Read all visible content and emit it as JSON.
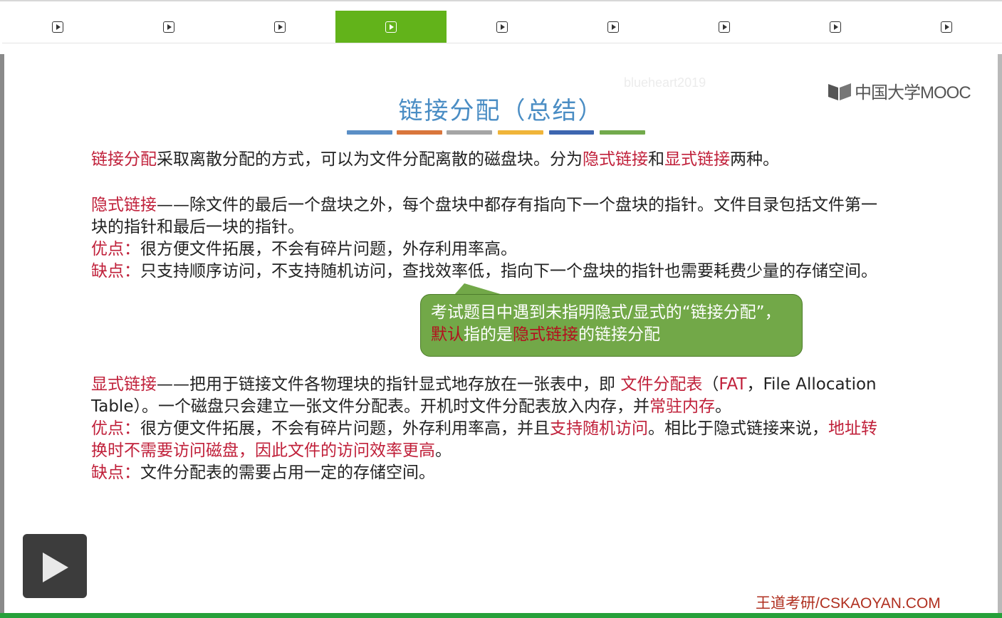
{
  "tabs": [
    {
      "icon": "play-icon",
      "active": false
    },
    {
      "icon": "play-icon",
      "active": false
    },
    {
      "icon": "play-icon",
      "active": false
    },
    {
      "icon": "play-icon",
      "active": true
    },
    {
      "icon": "play-icon",
      "active": false
    },
    {
      "icon": "play-icon",
      "active": false
    },
    {
      "icon": "play-icon",
      "active": false
    },
    {
      "icon": "play-icon",
      "active": false
    },
    {
      "icon": "play-icon",
      "active": false
    }
  ],
  "colors": {
    "active_tab": "#62b31a",
    "title": "#4a8dc4",
    "emphasis": "#c0203a",
    "callout_bg": "#72a848",
    "title_bars": [
      "#5b8fc6",
      "#d9763c",
      "#a5a5a5",
      "#f0b53a",
      "#3d66b0",
      "#72aa4c"
    ]
  },
  "slide": {
    "watermark": "blueheart2019",
    "logo_text": "中国大学MOOC",
    "title": "链接分配（总结）",
    "intro": {
      "t1": "链接分配",
      "t2": "采取离散分配的方式，可以为文件分配离散的磁盘块。分为",
      "t3": "隐式链接",
      "t4": "和",
      "t5": "显式链接",
      "t6": "两种。"
    },
    "implicit": {
      "head": "隐式链接",
      "desc": "——除文件的最后一个盘块之外，每个盘块中都存有指向下一个盘块的指针。文件目录包括文件第一块的指针和最后一块的指针。",
      "pros_label": "优点：",
      "pros": "很方便文件拓展，不会有碎片问题，外存利用率高。",
      "cons_label": "缺点：",
      "cons": "只支持顺序访问，不支持随机访问，查找效率低，指向下一个盘块的指针也需要耗费少量的存储空间。"
    },
    "callout": {
      "t1": "考试题目中遇到未指明隐式/显式的“链接分配”，",
      "t2": "默认",
      "t3": "指的是",
      "t4": "隐式链接",
      "t5": "的链接分配"
    },
    "explicit": {
      "head": "显式链接",
      "d1": "——把用于链接文件各物理块的指针显式地存放在一张表中，即 ",
      "d2": "文件分配表",
      "d3": "（",
      "d4": "FAT",
      "d5": "，File Allocation Table）。一个磁盘只会建立一张文件分配表。开机时文件分配表放入内存，并",
      "d6": "常驻内存",
      "d7": "。",
      "pros_label": "优点：",
      "p1": "很方便文件拓展，不会有碎片问题，外存利用率高，并且",
      "p2": "支持随机访问",
      "p3": "。相比于隐式链接来说，",
      "p4": "地址转换时不需要访问磁盘，因此文件的访问效率更高",
      "p5": "。",
      "cons_label": "缺点：",
      "cons": "文件分配表的需要占用一定的存储空间。"
    },
    "footer": "王道考研/CSKAOYAN.COM"
  }
}
